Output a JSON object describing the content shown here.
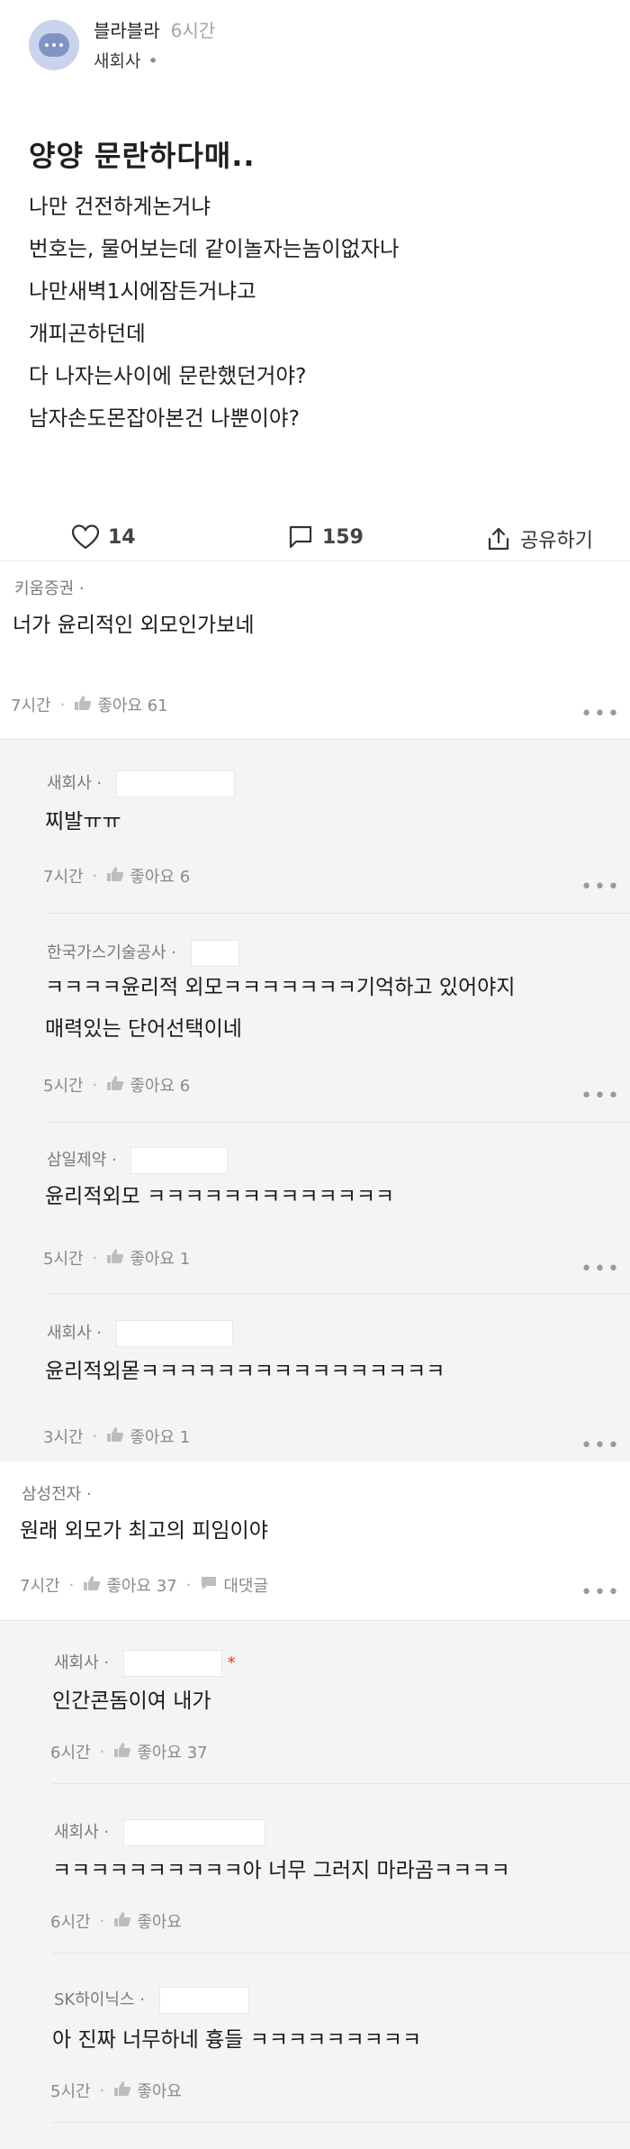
{
  "post": {
    "author_name": "블라블라",
    "time": "6시간",
    "company": "새회사",
    "company_dot": "•",
    "title": "양양 문란하다매..",
    "lines": [
      "나만 건전하게논거냐",
      "번호는, 물어보는데 같이놀자는놈이없자나",
      "나만새벽1시에잠든거냐고",
      "개피곤하던데",
      "다 나자는사이에 문란했던거야?",
      "남자손도몬잡아본건 나뿐이야?"
    ],
    "likes": "14",
    "comments": "159",
    "share_label": "공유하기"
  },
  "comments": [
    {
      "company": "키움증권",
      "dot": "·",
      "text": "너가 윤리적인 외모인가보네",
      "time": "7시간",
      "like_label": "좋아요 61",
      "more": "•••"
    },
    {
      "company": "새회사",
      "dot": "·",
      "text": "찌발ㅠㅠ",
      "time": "7시간",
      "like_label": "좋아요 6",
      "more": "•••"
    },
    {
      "company": "한국가스기술공사",
      "dot": "·",
      "text_lines": [
        "ㅋㅋㅋㅋ윤리적 외모ㅋㅋㅋㅋㅋㅋㅋ기억하고 있어야지",
        "매력있는 단어선택이네"
      ],
      "time": "5시간",
      "like_label": "좋아요 6",
      "more": "•••"
    },
    {
      "company": "삼일제약",
      "dot": "·",
      "text": "윤리적외모 ㅋㅋㅋㅋㅋㅋㅋㅋㅋㅋㅋㅋㅋ",
      "time": "5시간",
      "like_label": "좋아요 1",
      "more": "•••"
    },
    {
      "company": "새회사",
      "dot": "·",
      "text": "윤리적외몯ㅋㅋㅋㅋㅋㅋㅋㅋㅋㅋㅋㅋㅋㅋㅋㅋ",
      "time": "3시간",
      "like_label": "좋아요 1",
      "more": "•••"
    },
    {
      "company": "삼성전자",
      "dot": "·",
      "text": "원래 외모가 최고의 피임이야",
      "time": "7시간",
      "like_label": "좋아요 37",
      "reply_label": "대댓글",
      "more": "•••"
    },
    {
      "company": "새회사",
      "dot": "·",
      "star": "*",
      "text": "인간콘돔이여 내가",
      "time": "6시간",
      "like_label": "좋아요 37"
    },
    {
      "company": "새회사",
      "dot": "·",
      "text": "ㅋㅋㅋㅋㅋㅋㅋㅋㅋㅋ아 너무 그러지 마라곰ㅋㅋㅋㅋ",
      "time": "6시간",
      "like_label": "좋아요"
    },
    {
      "company": "SK하이닉스",
      "dot": "·",
      "text": "아 진짜 너무하네 흉들 ㅋㅋㅋㅋㅋㅋㅋㅋㅋ",
      "time": "5시간",
      "like_label": "좋아요"
    }
  ]
}
